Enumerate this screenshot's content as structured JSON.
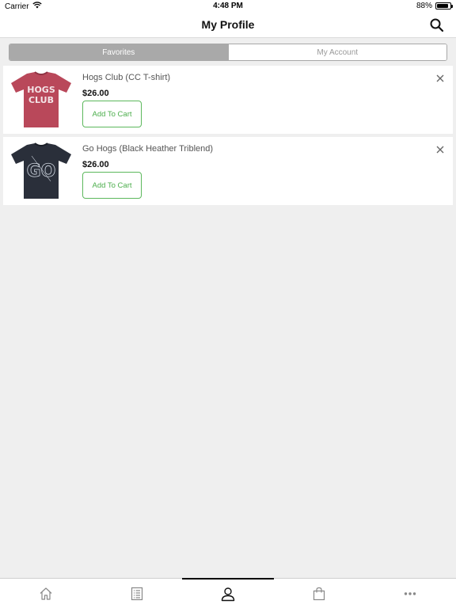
{
  "status_bar": {
    "carrier": "Carrier",
    "time": "4:48 PM",
    "battery": "88%",
    "battery_level": 0.88,
    "wifi_icon": "wifi-icon"
  },
  "nav_bar": {
    "title": "My Profile",
    "search_icon": "search-icon"
  },
  "segments": {
    "favorites": "Favorites",
    "my_account": "My Account",
    "selected": "favorites"
  },
  "favorites": [
    {
      "name": "Hogs Club (CC T-shirt)",
      "price": "$26.00",
      "button": "Add To Cart",
      "shirt_color": "#b9485a",
      "shirt_print": "HOGS CLUB"
    },
    {
      "name": "Go Hogs (Black Heather Triblend)",
      "price": "$26.00",
      "button": "Add To Cart",
      "shirt_color": "#2a2f3a",
      "shirt_print": "GO"
    }
  ],
  "tab_bar": {
    "tabs": [
      {
        "icon": "home-icon"
      },
      {
        "icon": "list-icon"
      },
      {
        "icon": "profile-icon",
        "selected": true
      },
      {
        "icon": "shopping-bag-icon"
      },
      {
        "icon": "more-icon"
      }
    ]
  },
  "colors": {
    "accent_green": "#4cae4c",
    "segment_active": "#a9a9a9",
    "background": "#efefef"
  }
}
